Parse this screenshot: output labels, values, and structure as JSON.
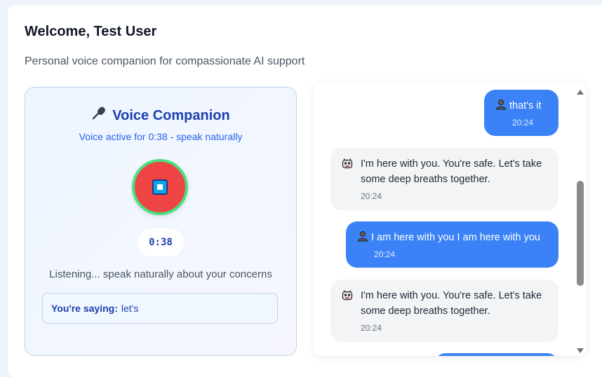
{
  "header": {
    "welcome": "Welcome, Test User",
    "subtitle": "Personal voice companion for compassionate AI support"
  },
  "voice": {
    "icon": "microphone-icon",
    "title": "Voice Companion",
    "status": "Voice active for 0:38 - speak naturally",
    "stop_icon": "stop-icon",
    "timer": "0:38",
    "listening": "Listening... speak naturally about your concerns",
    "saying_label": "You're saying:",
    "saying_text": "let's"
  },
  "chat": {
    "messages": [
      {
        "role": "user",
        "icon": "person-icon",
        "text": "that's it",
        "time": "20:24"
      },
      {
        "role": "assistant",
        "icon": "robot-icon",
        "text": "I'm here with you. You're safe. Let's take some deep breaths together.",
        "time": "20:24"
      },
      {
        "role": "user",
        "icon": "person-icon",
        "text": "I am here with you I am here with you",
        "time": "20:24"
      },
      {
        "role": "assistant",
        "icon": "robot-icon",
        "text": "I'm here with you. You're safe. Let's take some deep breaths together.",
        "time": "20:24"
      },
      {
        "role": "user",
        "icon": "person-icon",
        "text": "",
        "time": ""
      }
    ]
  },
  "colors": {
    "accent": "#3b82f6",
    "title_blue": "#1e40af",
    "stop_button": "#ef4444",
    "active_ring": "#4ade80",
    "assistant_bubble": "#f3f4f6"
  }
}
